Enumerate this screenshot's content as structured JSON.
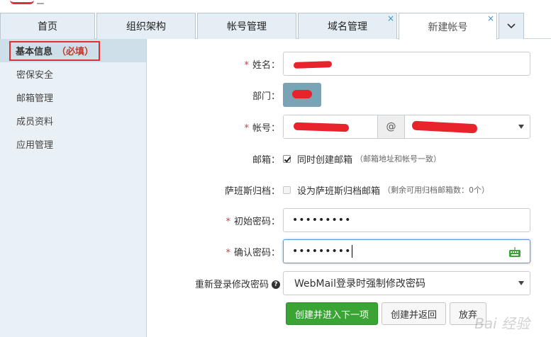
{
  "tabs": [
    {
      "label": "首页",
      "active": false,
      "closable": false
    },
    {
      "label": "组织架构",
      "active": false,
      "closable": false
    },
    {
      "label": "帐号管理",
      "active": false,
      "closable": false
    },
    {
      "label": "域名管理",
      "active": false,
      "closable": true
    },
    {
      "label": "新建帐号",
      "active": true,
      "closable": true
    }
  ],
  "tab_close_glyph": "×",
  "sidebar": {
    "items": [
      {
        "label": "基本信息",
        "required_label": "（必填）",
        "active": true
      },
      {
        "label": "密保安全"
      },
      {
        "label": "邮箱管理"
      },
      {
        "label": "成员资料"
      },
      {
        "label": "应用管理"
      }
    ]
  },
  "form": {
    "required_mark": "*",
    "name": {
      "label": "姓名："
    },
    "department": {
      "label": "部门："
    },
    "account": {
      "label": "帐号：",
      "at": "@"
    },
    "mailbox": {
      "label": "邮箱：",
      "checked": true,
      "text": "同时创建邮箱",
      "hint": "（邮箱地址和帐号一致）"
    },
    "sarbanes": {
      "label": "萨班斯归档：",
      "checked": false,
      "text": "设为萨班斯归档邮箱",
      "hint": "（剩余可用归档邮箱数：0个）"
    },
    "init_password": {
      "label": "初始密码：",
      "value": "•••••••••"
    },
    "confirm_password": {
      "label": "确认密码：",
      "value": "•••••••••"
    },
    "relogin": {
      "label": "重新登录修改密码",
      "help": "?",
      "selected": "WebMail登录时强制修改密码"
    }
  },
  "buttons": {
    "create_next": "创建并进入下一项",
    "create_return": "创建并返回",
    "cancel": "放弃"
  },
  "watermark": "Bai 经验",
  "colors": {
    "primary_button": "#3aa535",
    "tab_bg": "#e4eef4",
    "sidebar_bg": "#e9f1f6",
    "sidebar_active_bg": "#cfdfea",
    "required": "#d23a3a",
    "highlight_box": "#e03030"
  },
  "icons": {
    "tab_more": "chevron-down-icon",
    "keyboard": "keyboard-icon",
    "help": "question-circle-icon"
  }
}
